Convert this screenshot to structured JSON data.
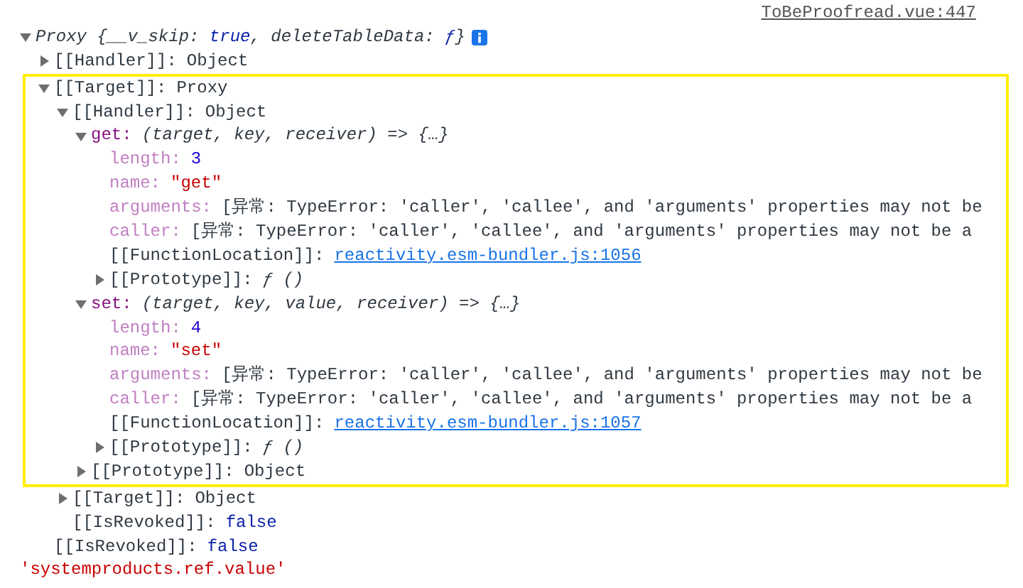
{
  "source_link": "ToBeProofread.vue:447",
  "root": {
    "expanded": true,
    "preview": [
      {
        "text": "Proxy {__v_skip: ",
        "kind": "plain"
      },
      {
        "text": "true",
        "kind": "boolean"
      },
      {
        "text": ", deleteTableData: ",
        "kind": "plain"
      },
      {
        "text": "ƒ",
        "kind": "fn"
      },
      {
        "text": "}",
        "kind": "plain"
      }
    ],
    "info_badge": true,
    "children": [
      {
        "key": "[[Handler]]:",
        "kind": "internal",
        "value": {
          "text": "Object",
          "kind": "plain"
        },
        "expanded": false
      },
      {
        "key": "[[Target]]:",
        "kind": "internal",
        "value": {
          "text": "Proxy",
          "kind": "plain"
        },
        "expanded": true,
        "highlighted": true,
        "children": [
          {
            "key": "[[Handler]]:",
            "kind": "internal",
            "value": {
              "text": "Object",
              "kind": "plain"
            },
            "expanded": true,
            "highlighted": true,
            "children": [
              {
                "key": "get:",
                "kind": "own",
                "value": {
                  "text": "(target, key, receiver) => {…}",
                  "kind": "function"
                },
                "expanded": true,
                "children": [
                  {
                    "key": "length:",
                    "kind": "hidden",
                    "value": {
                      "text": "3",
                      "kind": "number"
                    }
                  },
                  {
                    "key": "name:",
                    "kind": "hidden",
                    "value": {
                      "text": "\"get\"",
                      "kind": "string"
                    }
                  },
                  {
                    "key": "arguments:",
                    "kind": "hidden",
                    "value": {
                      "text": "[异常: TypeError: 'caller', 'callee', and 'arguments' properties may not be",
                      "kind": "plain"
                    }
                  },
                  {
                    "key": "caller:",
                    "kind": "hidden",
                    "value": {
                      "text": "[异常: TypeError: 'caller', 'callee', and 'arguments' properties may not be a",
                      "kind": "plain"
                    }
                  },
                  {
                    "key": "[[FunctionLocation]]:",
                    "kind": "internal",
                    "value": {
                      "text": "reactivity.esm-bundler.js:1056",
                      "kind": "link"
                    }
                  },
                  {
                    "key": "[[Prototype]]:",
                    "kind": "internal",
                    "value": {
                      "text": "ƒ ()",
                      "kind": "function"
                    },
                    "expanded": false
                  }
                ]
              },
              {
                "key": "set:",
                "kind": "own",
                "value": {
                  "text": "(target, key, value, receiver) => {…}",
                  "kind": "function"
                },
                "expanded": true,
                "children": [
                  {
                    "key": "length:",
                    "kind": "hidden",
                    "value": {
                      "text": "4",
                      "kind": "number"
                    }
                  },
                  {
                    "key": "name:",
                    "kind": "hidden",
                    "value": {
                      "text": "\"set\"",
                      "kind": "string"
                    }
                  },
                  {
                    "key": "arguments:",
                    "kind": "hidden",
                    "value": {
                      "text": "[异常: TypeError: 'caller', 'callee', and 'arguments' properties may not be",
                      "kind": "plain"
                    }
                  },
                  {
                    "key": "caller:",
                    "kind": "hidden",
                    "value": {
                      "text": "[异常: TypeError: 'caller', 'callee', and 'arguments' properties may not be a",
                      "kind": "plain"
                    }
                  },
                  {
                    "key": "[[FunctionLocation]]:",
                    "kind": "internal",
                    "value": {
                      "text": "reactivity.esm-bundler.js:1057",
                      "kind": "link"
                    }
                  },
                  {
                    "key": "[[Prototype]]:",
                    "kind": "internal",
                    "value": {
                      "text": "ƒ ()",
                      "kind": "function"
                    },
                    "expanded": false
                  }
                ]
              },
              {
                "key": "[[Prototype]]:",
                "kind": "internal",
                "value": {
                  "text": "Object",
                  "kind": "plain"
                },
                "expanded": false
              }
            ]
          },
          {
            "key": "[[Target]]:",
            "kind": "internal",
            "value": {
              "text": "Object",
              "kind": "plain"
            },
            "expanded": false
          },
          {
            "key": "[[IsRevoked]]:",
            "kind": "internal",
            "value": {
              "text": "false",
              "kind": "boolean"
            }
          }
        ]
      },
      {
        "key": "[[IsRevoked]]:",
        "kind": "internal",
        "value": {
          "text": "false",
          "kind": "boolean"
        }
      }
    ]
  },
  "next_message": "'systemproducts.ref.value'"
}
